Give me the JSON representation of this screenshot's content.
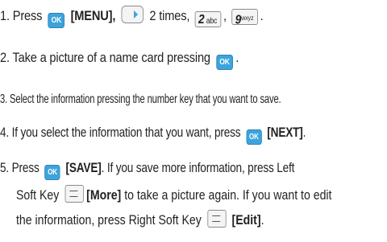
{
  "steps": [
    {
      "num": "1.",
      "t1": "Press",
      "menu": "[MENU],",
      "times": "2 times,",
      "comma": ",",
      "period": "."
    },
    {
      "num": "2.",
      "text": "Take a picture of a name card pressing",
      "period": "."
    },
    {
      "num": "3.",
      "text": "Select the information pressing the number key that you want to save."
    },
    {
      "num": "4.",
      "text": "If you select the information that you want, press",
      "next": "[NEXT]",
      "period": "."
    },
    {
      "num": "5.",
      "t1": "Press",
      "save": "[SAVE]",
      "t2": ". If you save more information, press Left",
      "line2a": "Soft Key",
      "more": "[More]",
      "line2b": "to take a picture again. If you want to edit",
      "line3a": "the information, press Right Soft Key",
      "edit": "[Edit]",
      "period": "."
    }
  ],
  "keys": {
    "ok": "OK",
    "key2_digit": "2",
    "key2_letters": "abc",
    "key9_digit": "9",
    "key9_letters": "wxyz"
  },
  "colors": {
    "ok_key": "#3ea3dd",
    "text": "#231f20"
  },
  "icons": [
    "ok-key-icon",
    "nav-right-key-icon",
    "number-key-2-icon",
    "number-key-9-icon",
    "left-soft-key-icon",
    "right-soft-key-icon"
  ]
}
